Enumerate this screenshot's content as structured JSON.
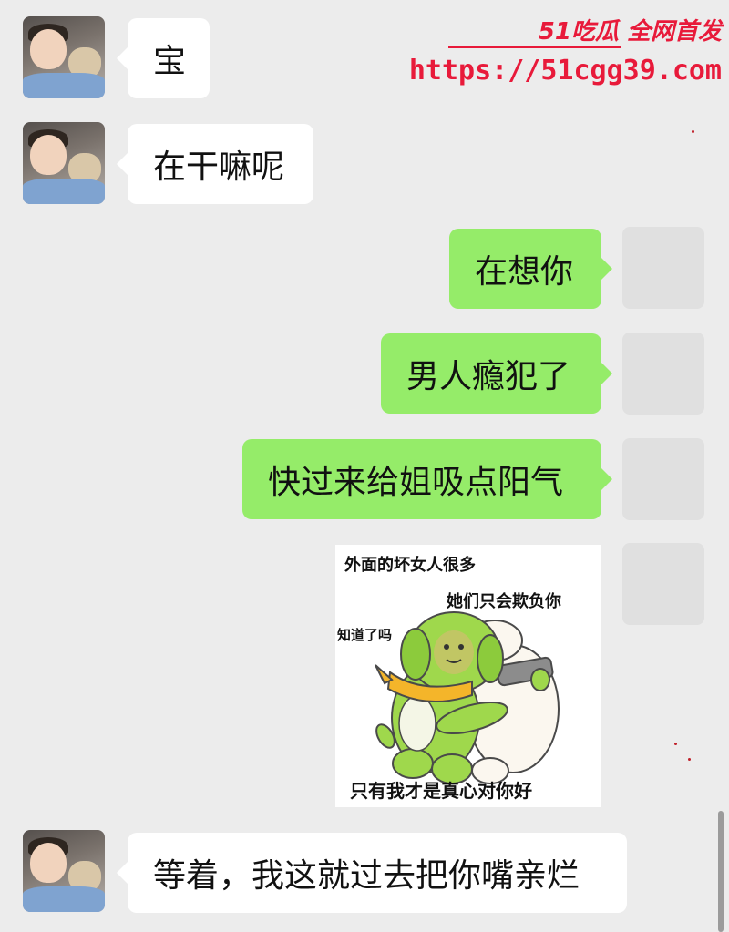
{
  "watermark": {
    "brand": "51吃瓜 全网首发",
    "url": "https://51cgg39.com"
  },
  "messages": [
    {
      "side": "left",
      "text": "宝"
    },
    {
      "side": "left",
      "text": "在干嘛呢"
    },
    {
      "side": "right",
      "text": "在想你"
    },
    {
      "side": "right",
      "text": "男人瘾犯了"
    },
    {
      "side": "right",
      "text": "快过来给姐吸点阳气"
    },
    {
      "side": "right",
      "type": "sticker"
    },
    {
      "side": "left",
      "text": "等着，我这就过去把你嘴亲烂"
    }
  ],
  "sticker": {
    "line1": "外面的坏女人很多",
    "line2": "她们只会欺负你",
    "line3": "知道了吗",
    "line4": "只有我才是真心对你好"
  },
  "colors": {
    "background": "#ececec",
    "bubble_self": "#95ec69",
    "bubble_other": "#ffffff",
    "watermark": "#e81a3a"
  }
}
